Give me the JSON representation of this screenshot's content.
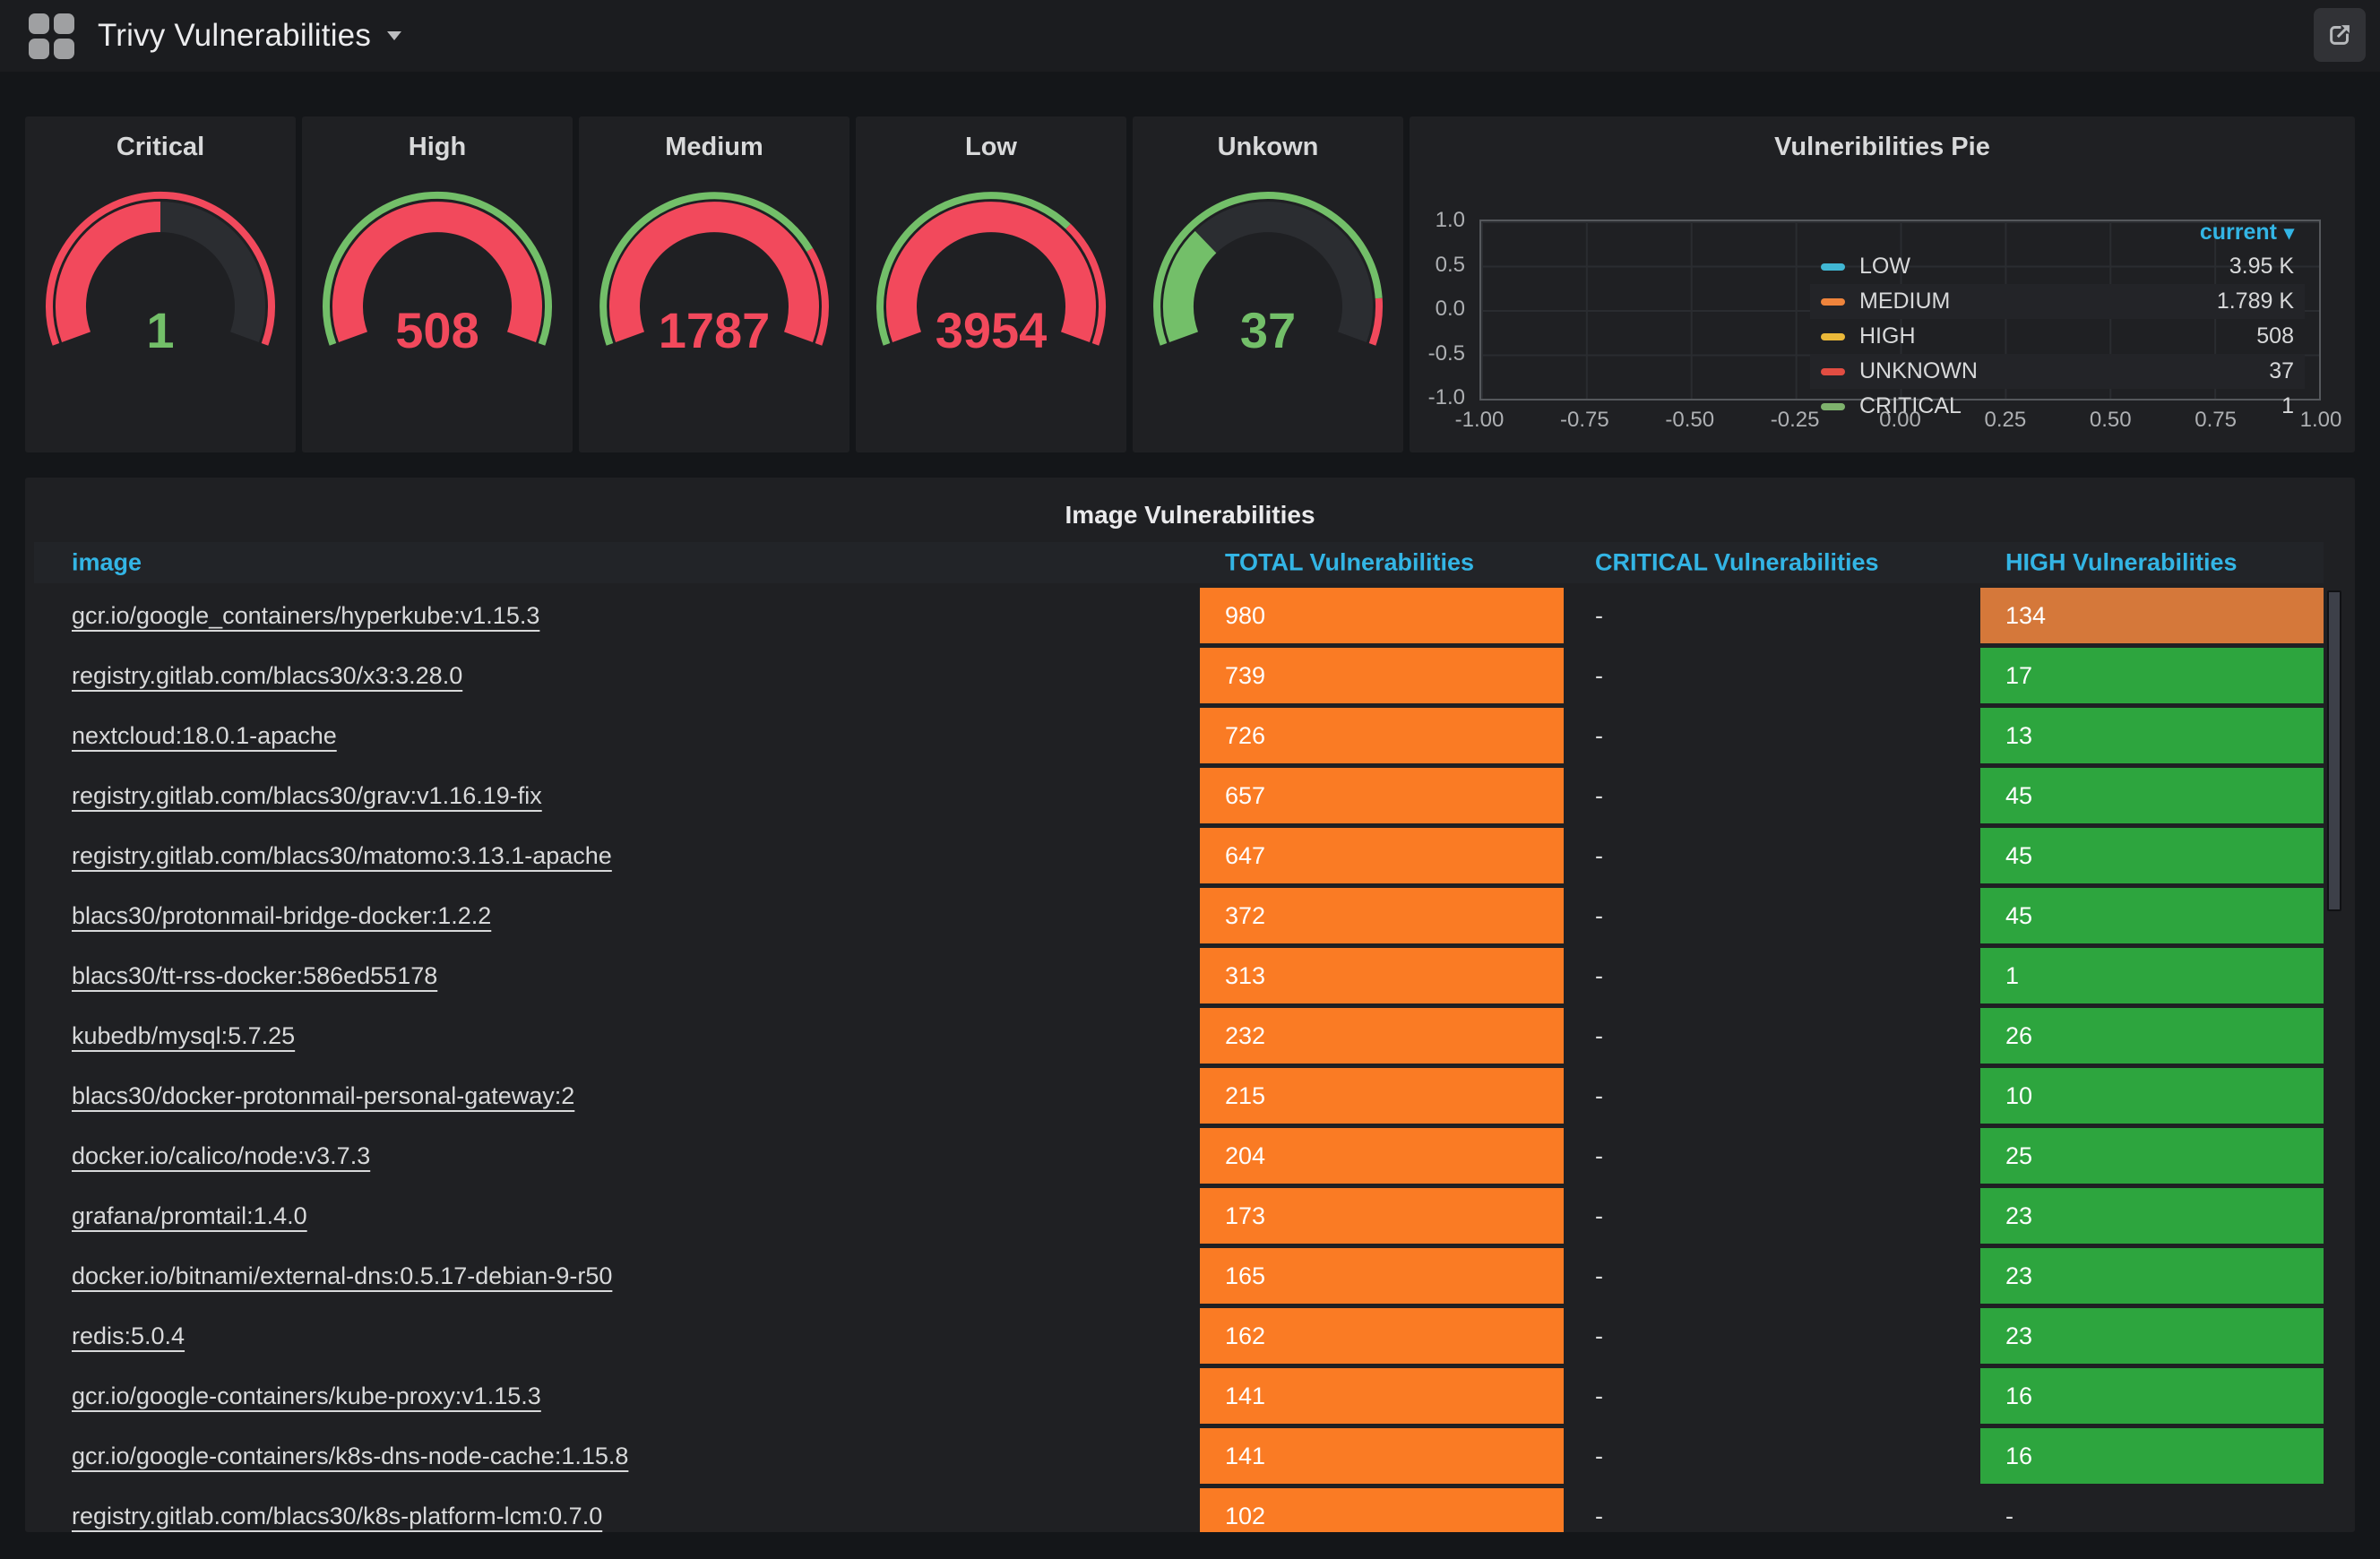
{
  "nav": {
    "title": "Trivy Vulnerabilities"
  },
  "share_label": "share-dashboard",
  "colors": {
    "red": "#F2495C",
    "green": "#73BF69",
    "track": "#2b2d31",
    "cyan_header": "#33B5E5",
    "total_cell_orange": "#fa7b24",
    "high_cell_orange": "#d5783a",
    "high_cell_green": "#2da53e"
  },
  "gauges": [
    {
      "title": "Critical",
      "value": "1",
      "value_color": "#73BF69",
      "fill_color": "#F2495C",
      "fill_pct": 0.5,
      "ring": [
        {
          "color": "#F2495C",
          "from": 0,
          "to": 1
        }
      ]
    },
    {
      "title": "High",
      "value": "508",
      "value_color": "#F2495C",
      "fill_color": "#F2495C",
      "fill_pct": 1,
      "ring": [
        {
          "color": "#73BF69",
          "from": 0,
          "to": 1
        }
      ]
    },
    {
      "title": "Medium",
      "value": "1787",
      "value_color": "#F2495C",
      "fill_color": "#F2495C",
      "fill_pct": 1,
      "ring": [
        {
          "color": "#73BF69",
          "from": 0,
          "to": 0.77
        },
        {
          "color": "#F2495C",
          "from": 0.77,
          "to": 1
        }
      ]
    },
    {
      "title": "Low",
      "value": "3954",
      "value_color": "#F2495C",
      "fill_color": "#F2495C",
      "fill_pct": 1,
      "ring": [
        {
          "color": "#73BF69",
          "from": 0,
          "to": 0.7
        },
        {
          "color": "#F2495C",
          "from": 0.7,
          "to": 1
        }
      ]
    },
    {
      "title": "Unkown",
      "value": "37",
      "value_color": "#73BF69",
      "fill_color": "#73BF69",
      "fill_pct": 0.3,
      "ring": [
        {
          "color": "#73BF69",
          "from": 0,
          "to": 0.89
        },
        {
          "color": "#F2495C",
          "from": 0.89,
          "to": 1
        }
      ]
    }
  ],
  "pie": {
    "title": "Vulneribilities Pie",
    "legend_header": "current",
    "legend": [
      {
        "label": "LOW",
        "value": "3.95 K",
        "color": "#41B7D4"
      },
      {
        "label": "MEDIUM",
        "value": "1.789 K",
        "color": "#EF843C"
      },
      {
        "label": "HIGH",
        "value": "508",
        "color": "#EAB839"
      },
      {
        "label": "UNKNOWN",
        "value": "37",
        "color": "#E24D42"
      },
      {
        "label": "CRITICAL",
        "value": "1",
        "color": "#7EB26D"
      }
    ],
    "y_ticks": [
      "1.0",
      "0.5",
      "0.0",
      "-0.5",
      "-1.0"
    ],
    "x_ticks": [
      "-1.00",
      "-0.75",
      "-0.50",
      "-0.25",
      "0.00",
      "0.25",
      "0.50",
      "0.75",
      "1.00"
    ]
  },
  "table": {
    "title": "Image Vulnerabilities",
    "columns": {
      "image": "image",
      "total": "TOTAL Vulnerabilities",
      "critical": "CRITICAL Vulnerabilities",
      "high": "HIGH Vulnerabilities"
    },
    "rows": [
      {
        "image": "gcr.io/google_containers/hyperkube:v1.15.3",
        "total": "980",
        "critical": "-",
        "high": "134",
        "high_bg": "orange"
      },
      {
        "image": "registry.gitlab.com/blacs30/x3:3.28.0",
        "total": "739",
        "critical": "-",
        "high": "17",
        "high_bg": "green"
      },
      {
        "image": "nextcloud:18.0.1-apache",
        "total": "726",
        "critical": "-",
        "high": "13",
        "high_bg": "green"
      },
      {
        "image": "registry.gitlab.com/blacs30/grav:v1.16.19-fix",
        "total": "657",
        "critical": "-",
        "high": "45",
        "high_bg": "green"
      },
      {
        "image": "registry.gitlab.com/blacs30/matomo:3.13.1-apache",
        "total": "647",
        "critical": "-",
        "high": "45",
        "high_bg": "green"
      },
      {
        "image": "blacs30/protonmail-bridge-docker:1.2.2",
        "total": "372",
        "critical": "-",
        "high": "45",
        "high_bg": "green"
      },
      {
        "image": "blacs30/tt-rss-docker:586ed55178",
        "total": "313",
        "critical": "-",
        "high": "1",
        "high_bg": "green"
      },
      {
        "image": "kubedb/mysql:5.7.25",
        "total": "232",
        "critical": "-",
        "high": "26",
        "high_bg": "green"
      },
      {
        "image": "blacs30/docker-protonmail-personal-gateway:2",
        "total": "215",
        "critical": "-",
        "high": "10",
        "high_bg": "green"
      },
      {
        "image": "docker.io/calico/node:v3.7.3",
        "total": "204",
        "critical": "-",
        "high": "25",
        "high_bg": "green"
      },
      {
        "image": "grafana/promtail:1.4.0",
        "total": "173",
        "critical": "-",
        "high": "23",
        "high_bg": "green"
      },
      {
        "image": "docker.io/bitnami/external-dns:0.5.17-debian-9-r50",
        "total": "165",
        "critical": "-",
        "high": "23",
        "high_bg": "green"
      },
      {
        "image": "redis:5.0.4",
        "total": "162",
        "critical": "-",
        "high": "23",
        "high_bg": "green"
      },
      {
        "image": "gcr.io/google-containers/kube-proxy:v1.15.3",
        "total": "141",
        "critical": "-",
        "high": "16",
        "high_bg": "green"
      },
      {
        "image": "gcr.io/google-containers/k8s-dns-node-cache:1.15.8",
        "total": "141",
        "critical": "-",
        "high": "16",
        "high_bg": "green"
      },
      {
        "image": "registry.gitlab.com/blacs30/k8s-platform-lcm:0.7.0",
        "total": "102",
        "critical": "-",
        "high": "-",
        "high_bg": "none"
      }
    ]
  }
}
